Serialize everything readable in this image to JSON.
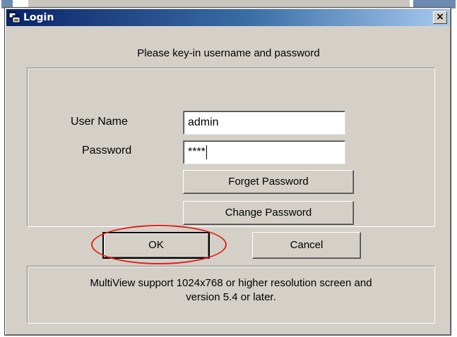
{
  "window": {
    "title": "Login",
    "close_glyph": "×"
  },
  "icons": {
    "title_icon": "app-windows-icon",
    "close_icon": "close-icon"
  },
  "prompt": "Please key-in username and password",
  "form": {
    "username_label": "User Name",
    "username_value": "admin",
    "password_label": "Password",
    "password_value": "****"
  },
  "buttons": {
    "forget_password": "Forget Password",
    "change_password": "Change Password",
    "ok": "OK",
    "cancel": "Cancel"
  },
  "notice": {
    "line1": "MultiView support 1024x768 or higher resolution screen and",
    "line2": "version 5.4 or later."
  },
  "colors": {
    "titlebar": "#0a246a",
    "dialog_bg": "#d4d0c8",
    "annotation": "#e0201a"
  }
}
